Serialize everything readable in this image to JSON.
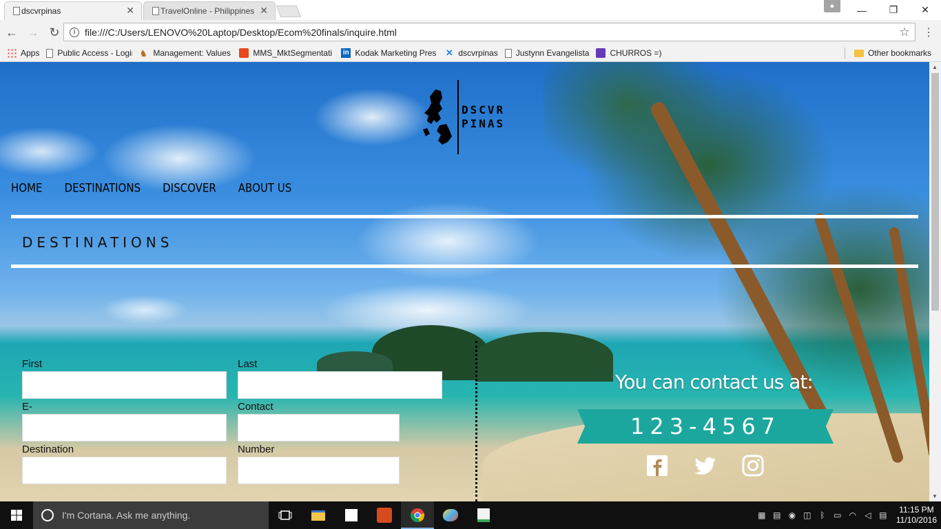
{
  "browser": {
    "tabs": [
      {
        "title": "dscvrpinas",
        "active": true
      },
      {
        "title": "TravelOnline - Philippines",
        "active": false
      }
    ],
    "address": "file:///C:/Users/LENOVO%20Laptop/Desktop/Ecom%20finals/inquire.html",
    "bookmarks": [
      {
        "label": "Apps",
        "icon": "apps-grid-icon"
      },
      {
        "label": "Public Access - Login",
        "icon": "page-icon"
      },
      {
        "label": "Management: Values",
        "icon": "wagon-icon"
      },
      {
        "label": "MMS_MktSegmentati",
        "icon": "ms-office-icon"
      },
      {
        "label": "Kodak Marketing Pres",
        "icon": "linkedin-icon"
      },
      {
        "label": "dscvrpinas",
        "icon": "x-logo-icon"
      },
      {
        "label": "Justynn Evangelista",
        "icon": "page-icon"
      },
      {
        "label": "CHURROS =)",
        "icon": "grid-icon"
      }
    ],
    "other_bookmarks": "Other bookmarks"
  },
  "site": {
    "logo_line1": "DSCVR",
    "logo_line2": "PINAS",
    "nav": [
      "HOME",
      "DESTINATIONS",
      "DISCOVER",
      "ABOUT US"
    ],
    "heading": "DESTINATIONS",
    "form": {
      "first_name": "First Name",
      "last_name": "Last Name",
      "email": "E-mail",
      "contact": "Contact",
      "destination": "Destination",
      "persons": "Number of persons"
    },
    "contact_title": "You can contact us at:",
    "phone": "123-4567",
    "social": [
      "facebook-icon",
      "twitter-icon",
      "instagram-icon"
    ]
  },
  "taskbar": {
    "cortana_placeholder": "I'm Cortana. Ask me anything.",
    "time": "11:15 PM",
    "date": "11/10/2016"
  },
  "colors": {
    "ribbon": "#1ba79d",
    "taskbar": "#101010",
    "chrome_bg": "#f2f2f2"
  }
}
